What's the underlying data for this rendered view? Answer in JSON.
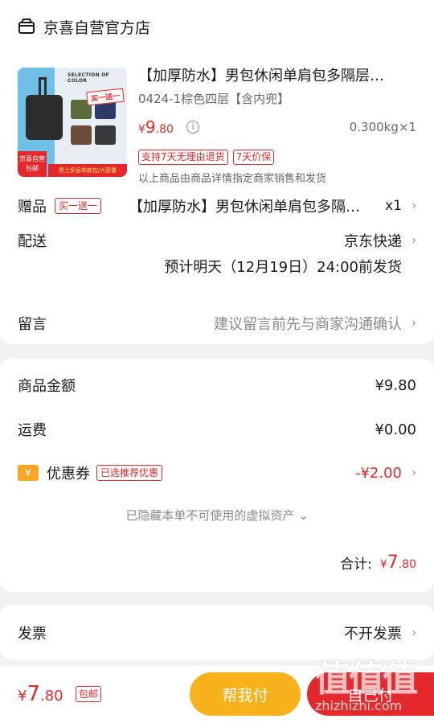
{
  "shop": {
    "name": "京喜自营官方店",
    "icon": "store-icon"
  },
  "product": {
    "title": "【加厚防水】男包休闲单肩包多隔层…",
    "spec": "0424-1棕色四层【含内兜】",
    "price_symbol": "¥",
    "price_int": "9",
    "price_dec": ".80",
    "weight_qty": "0.300kg×1",
    "badges": [
      "支持7天无理由退货",
      "7天价保"
    ],
    "note": "以上商品由商品详情指定商家销售和发货",
    "thumb": {
      "selection_text": "SELECTION OF COLOR",
      "promo_text": "买一送一",
      "tag_line1": "京喜自营",
      "tag_line2": "包邮",
      "banner": "男士多层单肩包/大容量"
    }
  },
  "gift": {
    "label": "赠品",
    "tag": "买一送一",
    "title": "【加厚防水】男包休闲单肩包多隔…",
    "qty": "x1"
  },
  "delivery": {
    "label": "配送",
    "method": "京东快递",
    "eta": "预计明天（12月19日）24:00前发货"
  },
  "message": {
    "label": "留言",
    "placeholder": "建议留言前先与商家沟通确认"
  },
  "summary": {
    "goods_label": "商品金额",
    "goods_value": "¥9.80",
    "shipping_label": "运费",
    "shipping_value": "¥0.00",
    "coupon_icon_text": "¥",
    "coupon_label": "优惠券",
    "coupon_tag": "已选推荐优惠",
    "coupon_value": "-¥2.00",
    "hidden_assets": "已隐藏本单不可使用的虚拟资产",
    "total_label": "合计:",
    "total_symbol": "¥",
    "total_int": "7",
    "total_dec": ".80"
  },
  "invoice": {
    "label": "发票",
    "value": "不开发票"
  },
  "bottom": {
    "price_symbol": "¥",
    "price_int": "7",
    "price_dec": ".80",
    "free_shipping": "包邮",
    "help_pay_label": "帮我付",
    "pay_label": "自己付"
  },
  "watermark": {
    "chars": "值值值",
    "url": "zhizhizhi.com"
  },
  "colors": {
    "accent_red": "#e5282b",
    "accent_yellow": "#f7b21b",
    "coupon_orange": "#f5a623"
  }
}
